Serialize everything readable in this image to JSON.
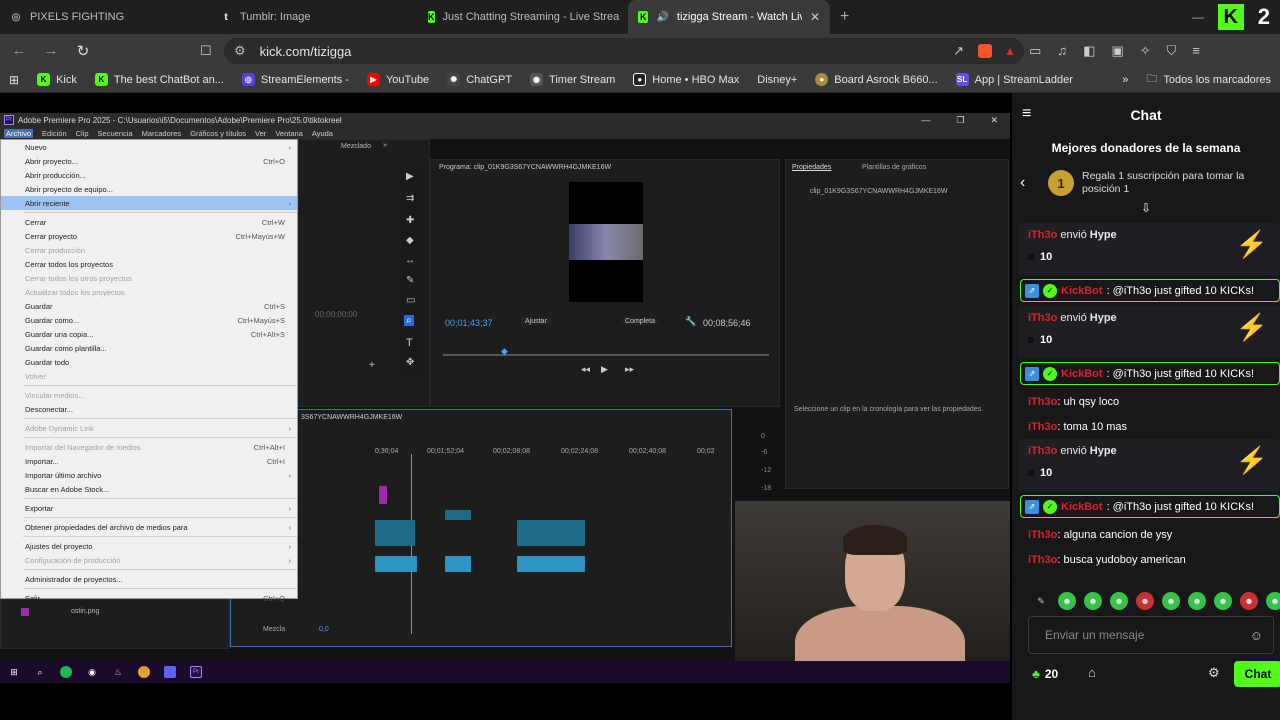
{
  "tabs": [
    {
      "label": "PIXELS FIGHTING",
      "icon": "globe-icon"
    },
    {
      "label": "Tumblr: Image",
      "icon": "tumblr-icon"
    },
    {
      "label": "Just Chatting Streaming - Live Strea",
      "icon": "kick-icon"
    },
    {
      "label": "tizigga Stream - Watch Live o",
      "icon": "kick-icon",
      "active": true
    }
  ],
  "address": {
    "url": "kick.com/tizigga"
  },
  "bookmarks": [
    {
      "label": "Kick",
      "color": "#53fc18"
    },
    {
      "label": "The best ChatBot an...",
      "color": "#2b2b2b"
    },
    {
      "label": "StreamElements -",
      "color": "#5a3fd4"
    },
    {
      "label": "YouTube",
      "color": "#ff0000"
    },
    {
      "label": "ChatGPT",
      "color": "#444"
    },
    {
      "label": "Timer Stream",
      "color": "#555"
    },
    {
      "label": "Home • HBO Max",
      "color": "#222"
    },
    {
      "label": "Disney+",
      "color": "#1a2a6c"
    },
    {
      "label": "Board Asrock B660...",
      "color": "#a88b3c"
    },
    {
      "label": "App | StreamLadder",
      "color": "#6a4de0"
    }
  ],
  "bookmarks_all": "Todos los marcadores",
  "premiere": {
    "title": "Adobe Premiere Pro 2025 - C:\\Usuarios\\i5\\Documentos\\Adobe\\Premiere Pro\\25.0\\tiktokreel",
    "menu": [
      "Archivo",
      "Edición",
      "Clip",
      "Secuencia",
      "Marcadores",
      "Gráficos y títulos",
      "Ver",
      "Ventana",
      "Ayuda"
    ],
    "dropdown": [
      {
        "label": "Nuevo",
        "shortcut": "",
        "arrow": true
      },
      {
        "label": "Abrir proyecto...",
        "shortcut": "Ctrl+O"
      },
      {
        "label": "Abrir producción...",
        "shortcut": ""
      },
      {
        "label": "Abrir proyecto de equipo...",
        "shortcut": ""
      },
      {
        "label": "Abrir reciente",
        "shortcut": "",
        "arrow": true,
        "selected": true
      },
      {
        "sep": true
      },
      {
        "label": "Cerrar",
        "shortcut": "Ctrl+W"
      },
      {
        "label": "Cerrar proyecto",
        "shortcut": "Ctrl+Mayús+W"
      },
      {
        "label": "Cerrar producción",
        "shortcut": "",
        "disabled": true
      },
      {
        "label": "Cerrar todos los proyectos",
        "shortcut": ""
      },
      {
        "label": "Cerrar todos los otros proyectos",
        "shortcut": "",
        "disabled": true
      },
      {
        "label": "Actualizar todos los proyectos",
        "shortcut": "",
        "disabled": true
      },
      {
        "label": "Guardar",
        "shortcut": "Ctrl+S"
      },
      {
        "label": "Guardar como...",
        "shortcut": "Ctrl+Mayús+S"
      },
      {
        "label": "Guardar una copia...",
        "shortcut": "Ctrl+Alt+S"
      },
      {
        "label": "Guardar como plantilla...",
        "shortcut": ""
      },
      {
        "label": "Guardar todo",
        "shortcut": ""
      },
      {
        "label": "Volver",
        "shortcut": "",
        "disabled": true
      },
      {
        "sep": true
      },
      {
        "label": "Vincular medios...",
        "shortcut": "",
        "disabled": true
      },
      {
        "label": "Desconectar...",
        "shortcut": ""
      },
      {
        "sep": true
      },
      {
        "label": "Adobe Dynamic Link",
        "shortcut": "",
        "disabled": true,
        "arrow": true
      },
      {
        "sep": true
      },
      {
        "label": "Importar del Navegador de medios",
        "shortcut": "Ctrl+Alt+I",
        "disabled": true
      },
      {
        "label": "Importar...",
        "shortcut": "Ctrl+I"
      },
      {
        "label": "Importar último archivo",
        "shortcut": "",
        "arrow": true
      },
      {
        "label": "Buscar en Adobe Stock...",
        "shortcut": ""
      },
      {
        "sep": true
      },
      {
        "label": "Exportar",
        "shortcut": "",
        "arrow": true
      },
      {
        "sep": true
      },
      {
        "label": "Obtener propiedades del archivo de medios para",
        "shortcut": "",
        "arrow": true
      },
      {
        "sep": true
      },
      {
        "label": "Ajustes del proyecto",
        "shortcut": "",
        "arrow": true
      },
      {
        "label": "Configuración de producción",
        "shortcut": "",
        "disabled": true,
        "arrow": true
      },
      {
        "sep": true
      },
      {
        "label": "Administrador de proyectos...",
        "shortcut": ""
      },
      {
        "sep": true
      },
      {
        "label": "Salir",
        "shortcut": "Ctrl+Q"
      }
    ],
    "project_title": "tiktokreel",
    "program_label": "Programa: clip_01K9G3S67YCNAWWRH4GJMKE16W",
    "timecode_current": "00;01;43;37",
    "timecode_total": "00;08;56;46",
    "fit": "Ajustar",
    "quality": "Completa",
    "source_timecode": "00;00;00;00",
    "properties_tab": "Propiedades",
    "graphics_tab": "Plantillas de gráficos",
    "properties_clip": "clip_01K9G3S67YCNAWWRH4GJMKE16W",
    "properties_hint": "Seleccione un clip en la cronología para ver las propiedades.",
    "mezclador": "Mezclado",
    "timeline_name": "3S67YCNAWWRH4GJMKE16W",
    "ruler": [
      "0;36;04",
      "00;01;52;04",
      "00;02;08;08",
      "00;02;24;08",
      "00;02;40;08",
      "00;02"
    ],
    "mix_label": "Mezcla",
    "mix_value": "0,0",
    "file_name": "ostin.png",
    "meter_values": [
      "0",
      "-6",
      "-12",
      "-18"
    ]
  },
  "chat": {
    "title": "Chat",
    "donors_title": "Mejores donadores de la semana",
    "donor_rank": "1",
    "donor_text": "Regala 1 suscripción para tomar la posición 1",
    "messages": [
      {
        "type": "hype",
        "user": "iTh3o",
        "action": "envió",
        "item": "Hype",
        "amount": "10"
      },
      {
        "type": "gift",
        "user": "KickBot",
        "text": ": @iTh3o just gifted 10 KICKs!"
      },
      {
        "type": "hype",
        "user": "iTh3o",
        "action": "envió",
        "item": "Hype",
        "amount": "10"
      },
      {
        "type": "gift",
        "user": "KickBot",
        "text": ": @iTh3o just gifted 10 KICKs!"
      },
      {
        "type": "line",
        "user": "iTh3o",
        "text": ": uh qsy loco"
      },
      {
        "type": "line",
        "user": "iTh3o",
        "text": ": toma 10 mas"
      },
      {
        "type": "hype",
        "user": "iTh3o",
        "action": "envió",
        "item": "Hype",
        "amount": "10"
      },
      {
        "type": "gift",
        "user": "KickBot",
        "text": ": @iTh3o just gifted 10 KICKs!"
      },
      {
        "type": "line",
        "user": "iTh3o",
        "text": ": alguna cancion de ysy"
      },
      {
        "type": "line",
        "user": "iTh3o",
        "text": ": busca yudoboy american"
      }
    ],
    "input_placeholder": "Enviar un mensaje",
    "points": "20",
    "send_label": "Chat"
  }
}
